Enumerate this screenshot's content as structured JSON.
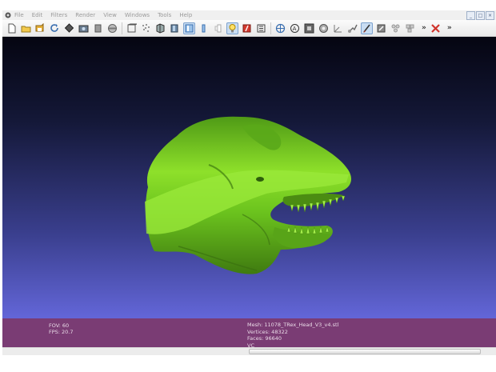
{
  "menu": {
    "items": [
      "File",
      "Edit",
      "Filters",
      "Render",
      "View",
      "Windows",
      "Tools",
      "Help"
    ]
  },
  "window_controls": {
    "minimize": "_",
    "restore": "□",
    "close": "×"
  },
  "toolbar": {
    "overflow_1": "»",
    "overflow_2": "»",
    "icons": [
      "new-icon",
      "open-icon",
      "save-icon",
      "reload-icon",
      "snapshot-icon",
      "export-icon",
      "layers-icon",
      "bounding-box-icon",
      "wireframe-icon",
      "points-icon",
      "flat-shading-icon",
      "smooth-shading-icon",
      "texture-icon",
      "light-icon",
      "color-icon",
      "selection-icon",
      "align-icon",
      "measure-icon",
      "paint-icon",
      "rotate-icon",
      "edit-tool-icon",
      "pen-icon",
      "raster-icon",
      "select-faces-icon",
      "select-vertices-icon",
      "delete-icon"
    ]
  },
  "info": {
    "fov": "FOV: 60",
    "fps": "FPS:   20.7",
    "mesh": "Mesh: 11078_TRex_Head_V3_v4.stl",
    "vertices": "Vertices: 48322",
    "faces": "Faces: 96640",
    "vc": "VC"
  },
  "colors": {
    "mesh": "#7ed321",
    "mesh_shadow": "#3f7a10",
    "info_bar": "#7a3c74",
    "viewport_top": "#050511",
    "viewport_bottom": "#6366d8"
  }
}
